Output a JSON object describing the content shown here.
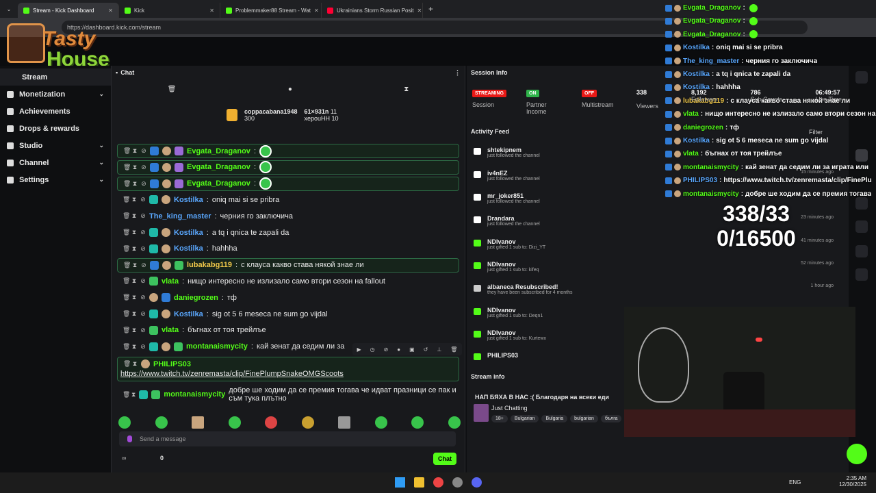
{
  "browser": {
    "tabs": [
      {
        "label": "Stream - Kick Dashboard",
        "active": true
      },
      {
        "label": "Kick"
      },
      {
        "label": "Problemmaker88 Stream - Wat"
      },
      {
        "label": "Ukrainians Storm Russian Posit"
      }
    ],
    "url": "https://dashboard.kick.com/stream"
  },
  "logo": {
    "line1": "Tasty",
    "line2": "House"
  },
  "sidebar": {
    "items": [
      {
        "label": "Stream"
      },
      {
        "label": "Monetization",
        "chevron": true
      },
      {
        "label": "Achievements"
      },
      {
        "label": "Drops & rewards"
      },
      {
        "label": "Studio",
        "chevron": true
      },
      {
        "label": "Channel",
        "chevron": true
      },
      {
        "label": "Settings",
        "chevron": true
      }
    ]
  },
  "chat": {
    "title": "Chat",
    "pinned": {
      "user1": "coppacabana1948",
      "val1": "300",
      "user2": "61×931n",
      "val2": "11",
      "user3": "херouHH",
      "val3": "10"
    },
    "messages": [
      {
        "user": "Evgata_Draganov",
        "text": "",
        "color": "#53fc18",
        "hl": true
      },
      {
        "user": "Evgata_Draganov",
        "text": "",
        "color": "#53fc18",
        "hl": true
      },
      {
        "user": "Evgata_Draganov",
        "text": "",
        "color": "#53fc18",
        "hl": true
      },
      {
        "user": "Kostilka",
        "text": "oniq mai si se pribra",
        "color": "#5aa8ff"
      },
      {
        "user": "The_king_master",
        "text": "черния го заключича",
        "color": "#5aa8ff"
      },
      {
        "user": "Kostilka",
        "text": "a tq i qnica te zapali da",
        "color": "#5aa8ff"
      },
      {
        "user": "Kostilka",
        "text": "hahhha",
        "color": "#5aa8ff"
      },
      {
        "user": "lubakabg119",
        "text": "с клауса какво става някой знае ли",
        "color": "#f0c84a",
        "hl": true
      },
      {
        "user": "vlata",
        "text": "нищо интересно не излизало само втори сезон на fallout",
        "color": "#53fc18"
      },
      {
        "user": "daniegrozen",
        "text": "тф",
        "color": "#53fc18"
      },
      {
        "user": "Kostilka",
        "text": "sig ot 5 6 meseca ne sum go vijdal",
        "color": "#5aa8ff"
      },
      {
        "user": "vlata",
        "text": "бъгнах от тоя трейлъе",
        "color": "#53fc18"
      },
      {
        "user": "montanaismycity",
        "text": "кай зенат да седим ли за",
        "color": "#53fc18"
      }
    ],
    "link_user": "PHILIPS03",
    "link": "https://www.twitch.tv/zenremasta/clip/FinePlumpSnakeOMGScoots",
    "last_user": "montanaismycity",
    "last_text": "добре ше ходим да се премия тогава че идват празници се пак и съм тука плътно",
    "placeholder": "Send a message",
    "count": "0",
    "send_label": "Chat"
  },
  "session": {
    "title": "Session Info",
    "stats": [
      {
        "pill": "STREAMING",
        "label": "Session",
        "color": "#e91916"
      },
      {
        "pill": "ON",
        "label": "Partner Income",
        "color": "#2fb34a"
      },
      {
        "pill": "OFF",
        "label": "Multistream",
        "color": "#e91916"
      }
    ],
    "viewers": "338",
    "viewers_label": "Viewers",
    "followers": "8,192",
    "followers_label": "Followers",
    "subs": "786",
    "subs_label": "Sub Counts",
    "time": "06:49:57",
    "time_label": "Live Time"
  },
  "activity": {
    "title": "Activity Feed",
    "filter": "Filter",
    "items": [
      {
        "name": "shtekipnem",
        "desc": "just followed the channel",
        "time": "",
        "type": "follow"
      },
      {
        "name": "iv4nEZ",
        "desc": "just followed the channel",
        "time": "15 minutes ago",
        "type": "follow"
      },
      {
        "name": "mr_joker851",
        "desc": "just followed the channel",
        "time": "",
        "type": "follow"
      },
      {
        "name": "Drandara",
        "desc": "just followed the channel",
        "time": "23 minutes ago",
        "type": "follow"
      },
      {
        "name": "NDIvanov",
        "desc": "just gifted 1 sub to: Dizi_YT",
        "time": "41 minutes ago",
        "type": "gift"
      },
      {
        "name": "NDIvanov",
        "desc": "just gifted 1 sub to: kifeq",
        "time": "52 minutes ago",
        "type": "gift"
      },
      {
        "name": "albaneca Resubscribed!",
        "desc": "they have been subscribed for 4 months",
        "time": "1 hour ago",
        "type": "resub"
      },
      {
        "name": "NDIvanov",
        "desc": "just gifted 1 sub to: Deqn1",
        "time": "",
        "type": "gift"
      },
      {
        "name": "NDIvanov",
        "desc": "just gifted 1 sub to: Kurtewx",
        "time": "",
        "type": "gift"
      },
      {
        "name": "PHILIPS03",
        "desc": "",
        "time": "",
        "type": "gift"
      }
    ]
  },
  "stream_info": {
    "title": "Stream info",
    "stream_title": "НАП БЯХА В НАС :( Благодаря на всеки еди",
    "category": "Just Chatting",
    "tags": [
      "18+",
      "Bulgarian",
      "Bulgaria",
      "bulgarian",
      "бълга"
    ]
  },
  "overlay": {
    "goal1": "338/33",
    "goal2": "0/16500",
    "lines": [
      {
        "user": "Evgata_Draganov",
        "text": "",
        "color": "#53fc18"
      },
      {
        "user": "Evgata_Draganov",
        "text": "",
        "color": "#53fc18"
      },
      {
        "user": "Evgata_Draganov",
        "text": "",
        "color": "#53fc18"
      },
      {
        "user": "Kostilka",
        "text": "oniq mai si se pribra",
        "color": "#5aa8ff"
      },
      {
        "user": "The_king_master",
        "text": "черния го заключича",
        "color": "#5aa8ff"
      },
      {
        "user": "Kostilka",
        "text": "a tq i qnica te zapali da",
        "color": "#5aa8ff"
      },
      {
        "user": "Kostilka",
        "text": "hahhha",
        "color": "#5aa8ff"
      },
      {
        "user": "lubakabg119",
        "text": "с клауса какво става някой знае ли",
        "color": "#f0c84a"
      },
      {
        "user": "vlata",
        "text": "нищо интересно не излизало само втори сезон на fal",
        "color": "#53fc18"
      },
      {
        "user": "daniegrozen",
        "text": "тф",
        "color": "#53fc18"
      },
      {
        "user": "Kostilka",
        "text": "sig ot 5 6 meseca ne sum go vijdal",
        "color": "#5aa8ff"
      },
      {
        "user": "vlata",
        "text": "бъгнах от тоя трейлъе",
        "color": "#53fc18"
      },
      {
        "user": "montanaismycity",
        "text": "кай зенат да седим ли за играта или",
        "color": "#53fc18"
      },
      {
        "user": "PHILIPS03",
        "text": "https://www.twitch.tv/zenremasta/clip/FinePlu",
        "color": "#5aa8ff"
      },
      {
        "user": "montanaismycity",
        "text": "добре ше ходим да се премия тогава",
        "color": "#53fc18"
      }
    ]
  },
  "taskbar": {
    "lang": "ENG",
    "time": "2:35 AM",
    "date": "12/30/2025"
  }
}
